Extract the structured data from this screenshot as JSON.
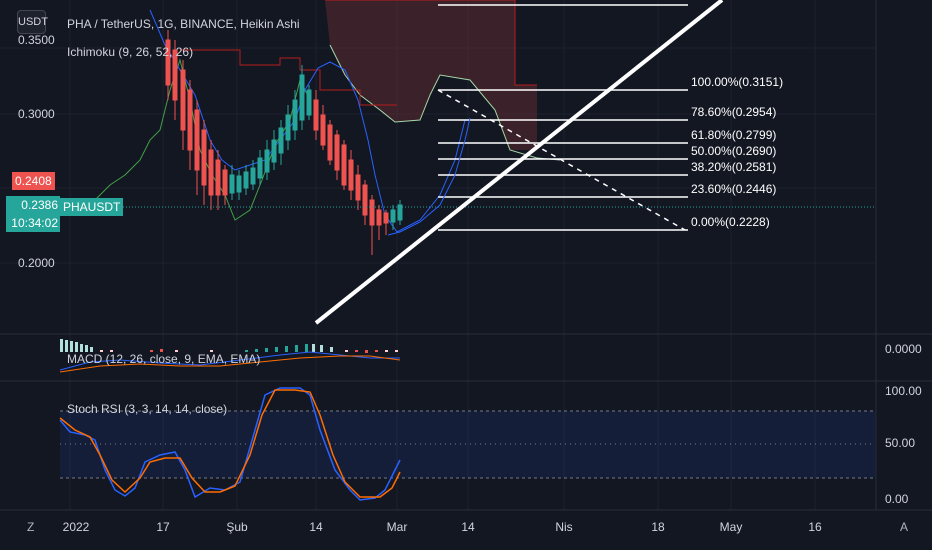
{
  "quote_currency": "USDT",
  "legend": {
    "main": "PHA / TetherUS, 1G, BINANCE, Heikin Ashi",
    "ichimoku": "Ichimoku (9, 26, 52, 26)",
    "macd": "MACD (12, 26, close, 9, EMA, EMA)",
    "stoch": "Stoch RSI (3, 3, 14, 14, close)"
  },
  "price_axis": [
    "0.3500",
    "0.3000",
    "0.2000"
  ],
  "current_price": {
    "value": "0.2386",
    "countdown": "10:34:02",
    "ticker": "PHAUSDT"
  },
  "red_marker": "0.2408",
  "macd_axis": "0.0000",
  "stoch_axis": [
    "100.00",
    "50.00",
    "0.00"
  ],
  "time_axis": [
    "2022",
    "17",
    "Şub",
    "14",
    "Mar",
    "14",
    "Nis",
    "18",
    "May",
    "16"
  ],
  "fib_labels": [
    "100.00%(0.3151)",
    "78.60%(0.2954)",
    "61.80%(0.2799)",
    "50.00%(0.2690)",
    "38.20%(0.2581)",
    "23.60%(0.2446)",
    "0.00%(0.2228)"
  ],
  "corner_left": "Z",
  "corner_right": "A",
  "colors": {
    "background": "#131722",
    "bull": "#26a69a",
    "bear": "#ef5350",
    "tenkan": "#2962ff",
    "kijun": "#b71c1c",
    "lagging": "#43a047",
    "leadB": "#a5d6a7",
    "cloud": "#5d2a2f",
    "stoch_k": "#2962ff",
    "stoch_d": "#ff6d00",
    "macd_line": "#2962ff",
    "signal_line": "#ff6d00",
    "price_line": "#26a69a"
  },
  "chart_data": {
    "type": "candlestick",
    "style": "Heikin Ashi",
    "symbol": "PHAUSDT",
    "interval": "1G",
    "exchange": "BINANCE",
    "last_price": 0.2386,
    "fib_levels": [
      {
        "ratio": 1.0,
        "price": 0.3151
      },
      {
        "ratio": 0.786,
        "price": 0.2954
      },
      {
        "ratio": 0.618,
        "price": 0.2799
      },
      {
        "ratio": 0.5,
        "price": 0.269
      },
      {
        "ratio": 0.382,
        "price": 0.2581
      },
      {
        "ratio": 0.236,
        "price": 0.2446
      },
      {
        "ratio": 0.0,
        "price": 0.2228
      }
    ],
    "stoch_rsi_bands": [
      80,
      20
    ]
  }
}
